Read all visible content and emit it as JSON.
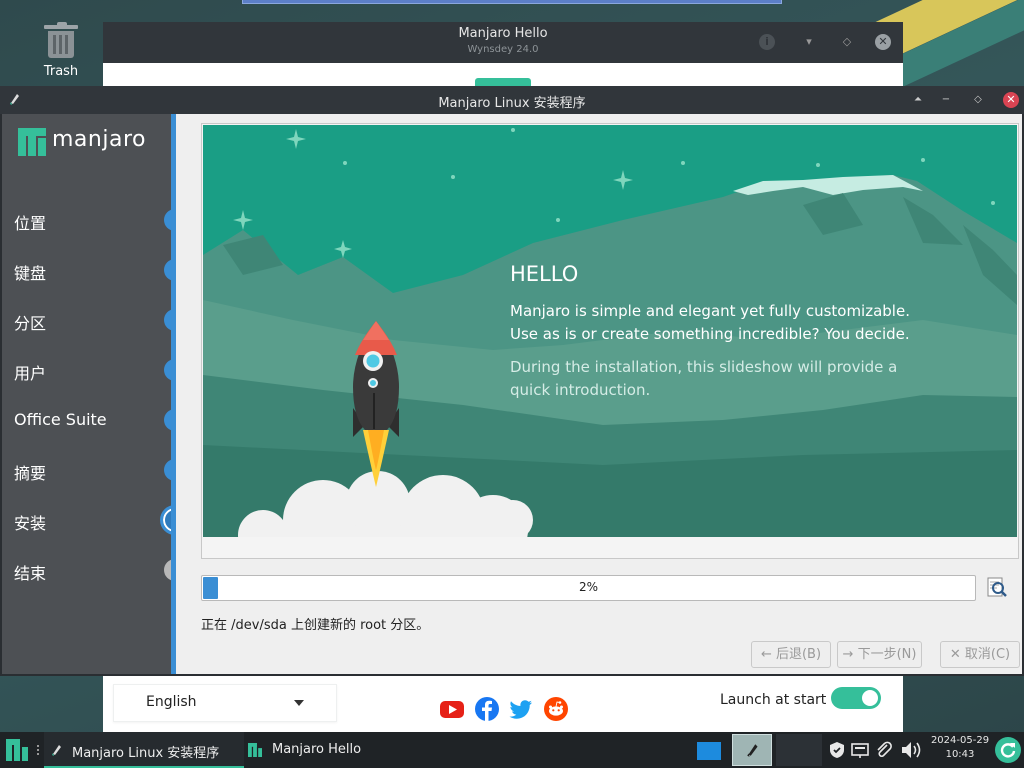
{
  "desktop": {
    "trash_label": "Trash"
  },
  "hello_window": {
    "title": "Manjaro Hello",
    "subtitle": "Wynsdey 24.0",
    "language_selected": "English",
    "launch_at_start_label": "Launch at start",
    "launch_at_start_on": true,
    "social_icons": [
      "youtube-icon",
      "facebook-icon",
      "twitter-icon",
      "reddit-icon"
    ]
  },
  "installer": {
    "title": "Manjaro Linux 安装程序",
    "logo_text": "manjaro",
    "steps": [
      {
        "label": "位置",
        "state": "done"
      },
      {
        "label": "键盘",
        "state": "done"
      },
      {
        "label": "分区",
        "state": "done"
      },
      {
        "label": "用户",
        "state": "done"
      },
      {
        "label": "Office Suite",
        "state": "done"
      },
      {
        "label": "摘要",
        "state": "done"
      },
      {
        "label": "安装",
        "state": "current"
      },
      {
        "label": "结束",
        "state": "pending"
      }
    ],
    "slide": {
      "heading": "HELLO",
      "paragraph1": "Manjaro is simple and elegant yet fully customizable. Use as is or create something incredible? You decide.",
      "paragraph2": "During the installation, this slideshow will provide a quick introduction."
    },
    "progress": {
      "value": 0.02,
      "text": "2%"
    },
    "status_text": "正在 /dev/sda 上创建新的 root 分区。",
    "buttons": {
      "back": "← 后退(B)",
      "next": "→ 下一步(N)",
      "cancel": "✕ 取消(C)"
    }
  },
  "taskbar": {
    "tasks": [
      {
        "label": "Manjaro Linux 安装程序",
        "active": true
      },
      {
        "label": "Manjaro Hello",
        "active": false
      }
    ],
    "date": "2024-05-29",
    "time": "10:43"
  },
  "colors": {
    "accent_blue": "#3a8ed4",
    "manjaro_green": "#35bf9a",
    "slide_teal": "#1a9e85"
  }
}
